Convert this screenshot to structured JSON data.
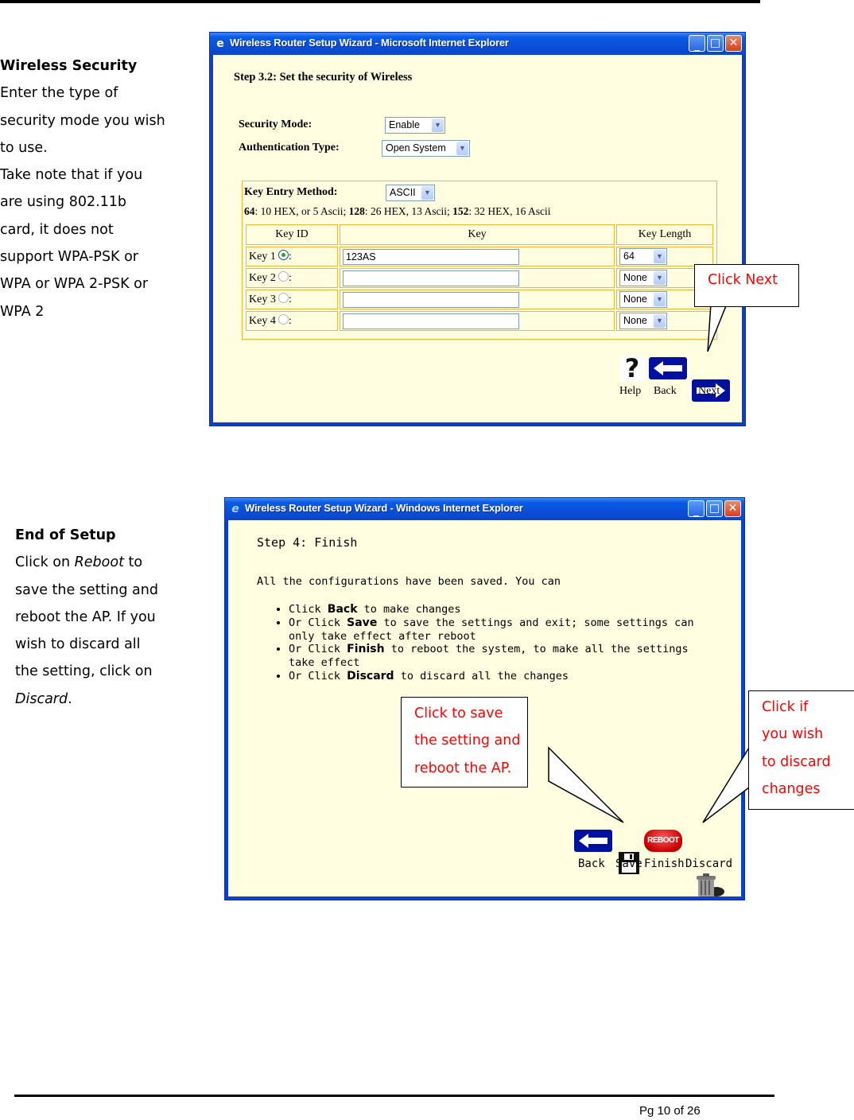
{
  "page": {
    "page_number_label": "Pg 10 of 26"
  },
  "section1": {
    "heading": "Wireless Security",
    "body_lines": [
      "Enter the type of",
      "security mode you wish",
      "to use.",
      "Take note that if you",
      "are using 802.11b",
      "card, it does not",
      "support WPA-PSK or",
      "WPA or WPA 2-PSK or",
      "WPA 2"
    ],
    "window": {
      "title": "Wireless Router Setup Wizard - Microsoft Internet Explorer",
      "step_title": "Step 3.2: Set the security of Wireless",
      "security_mode_label": "Security Mode:",
      "security_mode_value": "Enable",
      "auth_type_label": "Authentication Type:",
      "auth_type_value": "Open System",
      "key_entry_label": "Key Entry Method:",
      "key_entry_value": "ASCII",
      "hex_note": {
        "b64": "64",
        "t64": ": 10 HEX, or 5 Ascii; ",
        "b128": "128",
        "t128": ": 26 HEX, 13 Ascii; ",
        "b152": "152",
        "t152": ": 32 HEX, 16 Ascii"
      },
      "table_headers": [
        "Key ID",
        "Key",
        "Key Length"
      ],
      "keys": [
        {
          "label": "Key 1",
          "selected": true,
          "value": "123AS",
          "length": "64"
        },
        {
          "label": "Key 2",
          "selected": false,
          "value": "",
          "length": "None"
        },
        {
          "label": "Key 3",
          "selected": false,
          "value": "",
          "length": "None"
        },
        {
          "label": "Key 4",
          "selected": false,
          "value": "",
          "length": "None"
        }
      ],
      "buttons": {
        "help": "Help",
        "back": "Back",
        "next": "Next"
      }
    },
    "callout": "Click Next"
  },
  "section2": {
    "heading": "End of Setup",
    "body": {
      "p1": "Click on ",
      "reboot_em": "Reboot",
      "p2": " to",
      "lines": [
        "save the setting and",
        "reboot the AP. If you",
        "wish to discard all",
        "the setting, click on"
      ],
      "discard_em": "Discard",
      "end": "."
    },
    "window": {
      "title": "Wireless Router Setup Wizard - Windows Internet Explorer",
      "step_title": "Step 4: Finish",
      "intro": "All the configurations have been saved. You can",
      "bullets": [
        {
          "pre": "Click ",
          "bold": "Back",
          "post": " to make changes"
        },
        {
          "pre": "Or Click ",
          "bold": "Save",
          "post": " to save the settings and exit; some settings can only take effect after reboot"
        },
        {
          "pre": "Or Click ",
          "bold": "Finish",
          "post": " to reboot the system, to make all the settings take effect"
        },
        {
          "pre": "Or Click ",
          "bold": "Discard",
          "post": " to discard all the changes"
        }
      ],
      "buttons": {
        "back": "Back",
        "save": "Save",
        "finish": "Finish",
        "discard": "Discard",
        "reboot_badge": "REBOOT"
      }
    },
    "callout_save": [
      "Click to save",
      "the setting and",
      "reboot the AP."
    ],
    "callout_discard": [
      "Click if",
      "you wish",
      "to discard",
      "changes"
    ]
  }
}
